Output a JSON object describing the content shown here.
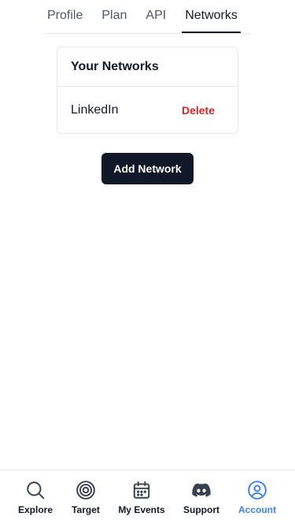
{
  "tabs": [
    {
      "label": "Profile",
      "active": false
    },
    {
      "label": "Plan",
      "active": false
    },
    {
      "label": "API",
      "active": false
    },
    {
      "label": "Networks",
      "active": true
    }
  ],
  "networks_card": {
    "title": "Your Networks",
    "items": [
      {
        "name": "LinkedIn",
        "action_label": "Delete"
      }
    ]
  },
  "add_network_button": {
    "label": "Add Network"
  },
  "bottom_nav": {
    "items": [
      {
        "label": "Explore",
        "icon": "search-icon",
        "active": false
      },
      {
        "label": "Target",
        "icon": "target-icon",
        "active": false
      },
      {
        "label": "My Events",
        "icon": "calendar-icon",
        "active": false
      },
      {
        "label": "Support",
        "icon": "discord-icon",
        "active": false
      },
      {
        "label": "Account",
        "icon": "user-circle-icon",
        "active": true
      }
    ]
  },
  "colors": {
    "primary_dark": "#111827",
    "danger": "#dc2626",
    "active_nav": "#3b82f6",
    "border": "#e5e7eb"
  }
}
